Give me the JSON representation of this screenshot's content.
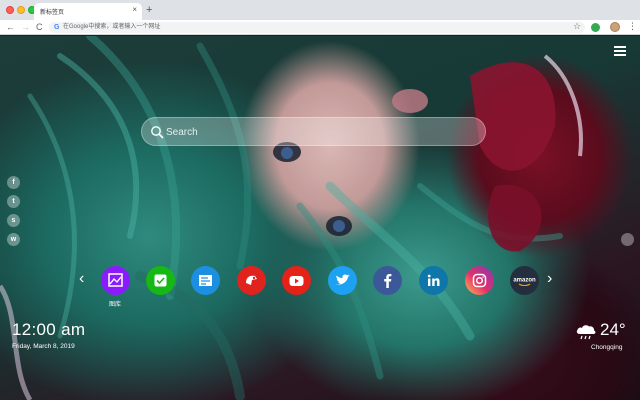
{
  "browser": {
    "tab_title": "新标签页",
    "tab_close": "×",
    "new_tab": "+",
    "omnibox_placeholder": "在Google中搜索，或者输入一个网址",
    "back": "←",
    "forward": "→",
    "reload": "C",
    "google_icon": "G",
    "star": "☆",
    "menu": "⋮"
  },
  "search": {
    "placeholder": "Search"
  },
  "social": [
    "f",
    "t",
    "s",
    "w"
  ],
  "dock": {
    "prev": "‹",
    "next": "›",
    "apps": [
      {
        "name": "gallery",
        "label": "图库",
        "color": "#8a1bff"
      },
      {
        "name": "check",
        "label": "",
        "color": "#16b814"
      },
      {
        "name": "notes",
        "label": "",
        "color": "#1c8fe0"
      },
      {
        "name": "game",
        "label": "",
        "color": "#e1231f"
      },
      {
        "name": "youtube",
        "label": "",
        "color": "#e62117"
      },
      {
        "name": "twitter",
        "label": "",
        "color": "#1da1f2"
      },
      {
        "name": "facebook",
        "label": "",
        "color": "#3b5998"
      },
      {
        "name": "linkedin",
        "label": "",
        "color": "#0e76a8"
      },
      {
        "name": "instagram",
        "label": "",
        "color": "#c13584"
      },
      {
        "name": "amazon",
        "label": "amazon",
        "color": "#232f3e"
      }
    ]
  },
  "clock": {
    "time": "12:00 am",
    "date": "Friday, March 8, 2019"
  },
  "weather": {
    "temperature": "24°",
    "city": "Chongqing",
    "icon": "cloud-rain-icon"
  }
}
